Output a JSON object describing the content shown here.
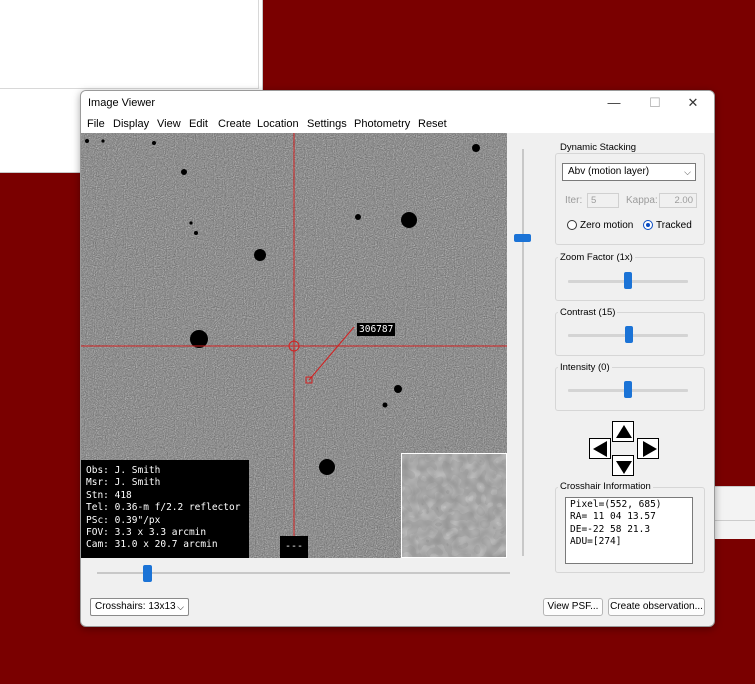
{
  "window": {
    "title": "Image Viewer",
    "minimize_glyph": "—",
    "maximize_glyph": "☐",
    "close_glyph": "✕"
  },
  "menu": [
    "File",
    "Display",
    "View",
    "Edit",
    "Create",
    "Location",
    "Settings",
    "Photometry",
    "Reset"
  ],
  "image": {
    "object_label": "306787",
    "info_lines": [
      "Obs: J. Smith",
      "Msr: J. Smith",
      "Stn: 418",
      "Tel: 0.36-m f/2.2 reflector",
      "PSc: 0.39\"/px",
      "FOV: 3.3 x 3.3 arcmin",
      "Cam: 31.0 x 20.7 arcmin"
    ],
    "small_box_text": "---",
    "crosshair_color": "#d22020"
  },
  "dynamic_stacking": {
    "title": "Dynamic Stacking",
    "mode": "Abv (motion layer)",
    "iter_label": "Iter:",
    "iter_value": "5",
    "kappa_label": "Kappa:",
    "kappa_value": "2.00",
    "zero_motion_label": "Zero motion",
    "tracked_label": "Tracked",
    "selected": "Tracked"
  },
  "zoom": {
    "label": "Zoom Factor (1x)",
    "value": 1
  },
  "contrast": {
    "label": "Contrast (15)",
    "value": 15
  },
  "intensity": {
    "label": "Intensity (0)",
    "value": 0
  },
  "crosshair_info": {
    "title": "Crosshair Information",
    "text": "Pixel=(552, 685)\nRA= 11 04 13.57\nDE=-22 58 21.3\nADU=[274]"
  },
  "bottom": {
    "crosshairs_combo": "Crosshairs: 13x13",
    "view_psf": "View PSF...",
    "create_observation": "Create observation..."
  },
  "colors": {
    "accent": "#1b73d6",
    "background": "#7a0000"
  }
}
